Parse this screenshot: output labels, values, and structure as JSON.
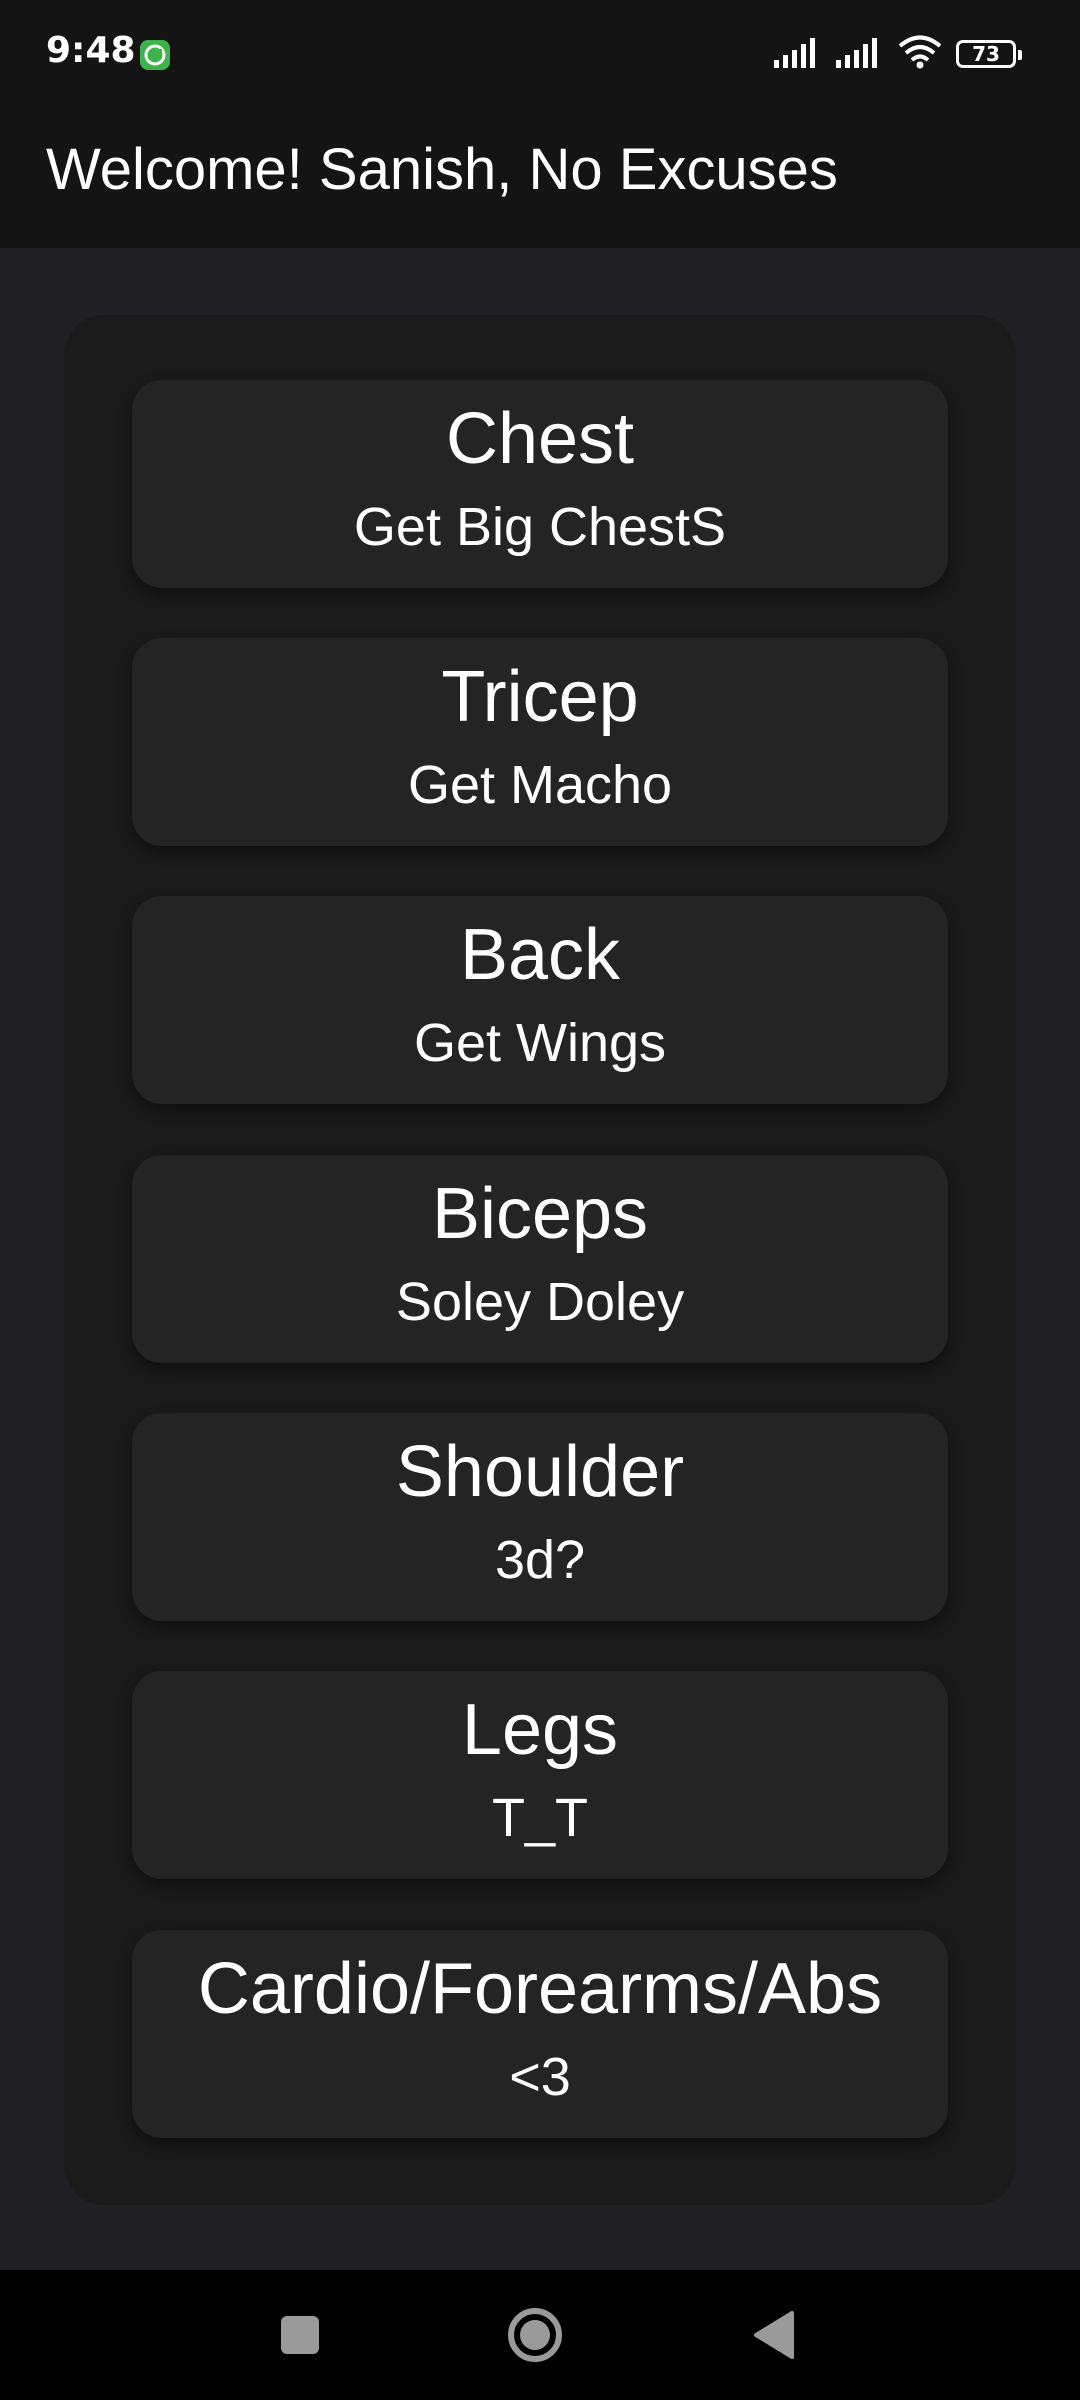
{
  "status_bar": {
    "time": "9:48",
    "battery": "73",
    "icons": [
      "app-notification-icon",
      "signal-icon",
      "signal-icon",
      "wifi-icon",
      "battery-icon"
    ]
  },
  "app_bar": {
    "title": "Welcome! Sanish, No Excuses"
  },
  "workouts": [
    {
      "title": "Chest",
      "subtitle": "Get Big ChestS"
    },
    {
      "title": "Tricep",
      "subtitle": "Get Macho"
    },
    {
      "title": "Back",
      "subtitle": "Get Wings"
    },
    {
      "title": "Biceps",
      "subtitle": "Soley Doley"
    },
    {
      "title": "Shoulder",
      "subtitle": "3d?"
    },
    {
      "title": "Legs",
      "subtitle": "T_T"
    },
    {
      "title": "Cardio/Forearms/Abs",
      "subtitle": "<3"
    }
  ],
  "nav_bar": {
    "buttons": [
      "recents-icon",
      "home-icon",
      "back-icon"
    ]
  },
  "colors": {
    "background": "#1f1f24",
    "bars": "#141414",
    "card": "#242424",
    "container": "#1a1a1a",
    "text": "#ffffff"
  }
}
